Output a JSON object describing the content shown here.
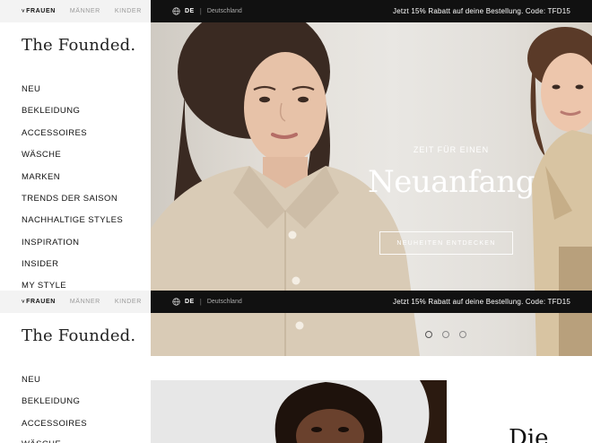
{
  "gender_tabs": [
    "FRAUEN",
    "MÄNNER",
    "KINDER"
  ],
  "language_code": "DE",
  "country": "Deutschland",
  "promo_text": "Jetzt 15% Rabatt auf deine Bestellung. Code: TFD15",
  "logo": "The Founded.",
  "nav": [
    "NEU",
    "BEKLEIDUNG",
    "ACCESSOIRES",
    "WÄSCHE",
    "MARKEN",
    "TRENDS DER SAISON",
    "NACHHALTIGE STYLES",
    "INSPIRATION",
    "INSIDER",
    "MY STYLE"
  ],
  "hero": {
    "kicker": "ZEIT FÜR EINEN",
    "title": "Neuanfang",
    "cta": "NEUHEITEN ENTDECKEN",
    "slides": 3,
    "active_slide": 1
  },
  "next_section": {
    "heading_partial": "Die"
  },
  "colors": {
    "promo_bar": "#111111",
    "gender_bar": "#f3f3f3",
    "hero_text": "#ffffff"
  },
  "icons": [
    "globe-icon",
    "chevron-down-icon"
  ]
}
